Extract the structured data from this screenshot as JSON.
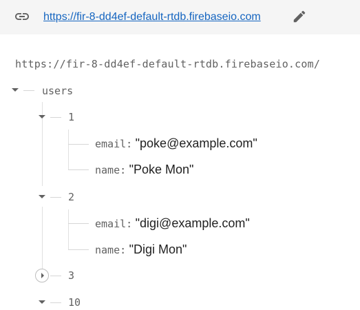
{
  "header": {
    "database_url": "https://fir-8-dd4ef-default-rtdb.firebaseio.com",
    "link_icon": "link-icon",
    "edit_icon": "pencil-icon"
  },
  "tree": {
    "root_path": "https://fir-8-dd4ef-default-rtdb.firebaseio.com/",
    "root_key": "users",
    "nodes": [
      {
        "key": "1",
        "fields": [
          {
            "key": "email:",
            "value": "\"poke@example.com\""
          },
          {
            "key": "name:",
            "value": "\"Poke Mon\""
          }
        ]
      },
      {
        "key": "2",
        "fields": [
          {
            "key": "email:",
            "value": "\"digi@example.com\""
          },
          {
            "key": "name:",
            "value": "\"Digi Mon\""
          }
        ]
      },
      {
        "key": "3",
        "collapsed": true
      },
      {
        "key": "10"
      }
    ]
  }
}
